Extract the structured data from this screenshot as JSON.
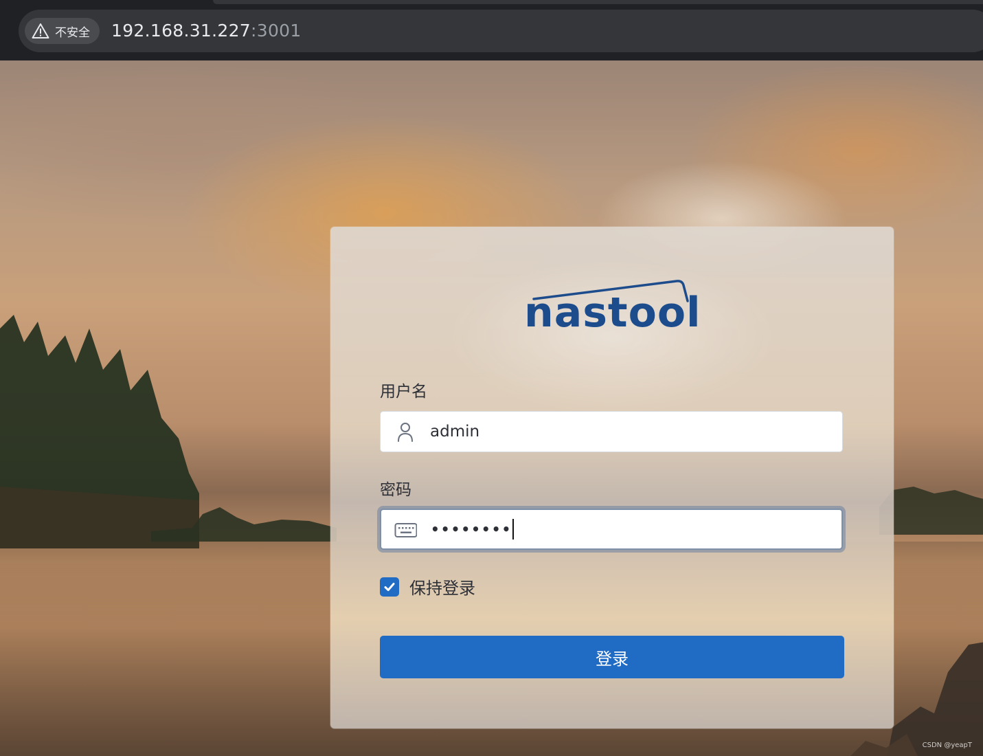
{
  "browser": {
    "security_label": "不安全",
    "url_host": "192.168.31.227",
    "url_port": ":3001"
  },
  "login": {
    "logo_text": "nastool",
    "username_label": "用户名",
    "username_value": "admin",
    "password_label": "密码",
    "password_value": "••••••••",
    "remember_label": "保持登录",
    "remember_checked": true,
    "submit_label": "登录"
  },
  "watermark": "CSDN @yeapT",
  "colors": {
    "accent": "#206bc4",
    "logo": "#1d4c8c"
  },
  "icons": {
    "security": "warning-triangle-icon",
    "username": "user-icon",
    "password": "keyboard-icon",
    "checkbox": "check-icon"
  }
}
